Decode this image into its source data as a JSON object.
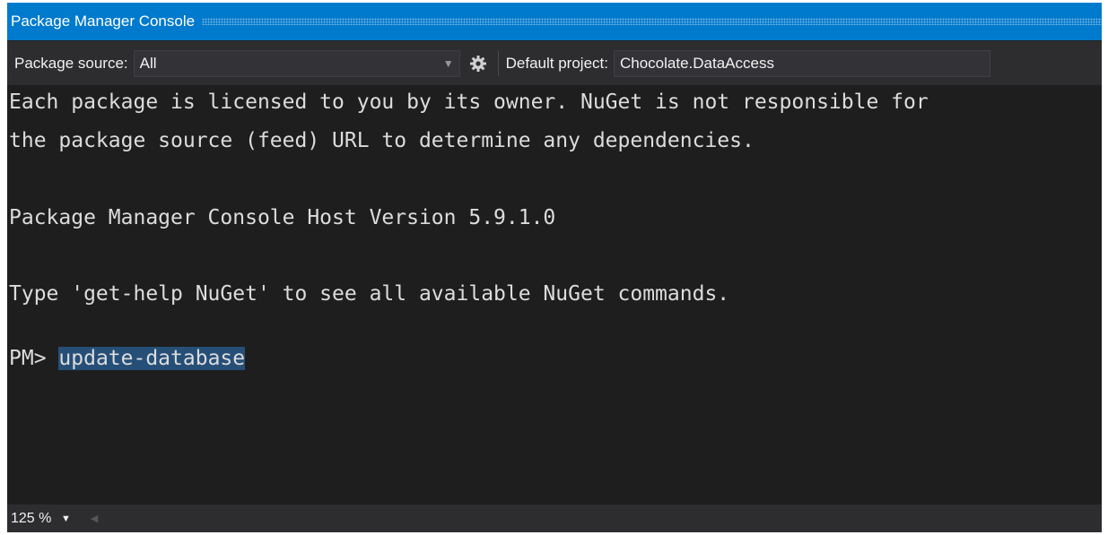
{
  "window": {
    "title": "Package Manager Console"
  },
  "toolbar": {
    "package_source_label": "Package source:",
    "package_source_value": "All",
    "default_project_label": "Default project:",
    "default_project_value": "Chocolate.DataAccess",
    "settings_icon": "gear-icon"
  },
  "console": {
    "lines": [
      "Each package is licensed to you by its owner. NuGet is not responsible for",
      "the package source (feed) URL to determine any dependencies.",
      "",
      "Package Manager Console Host Version 5.9.1.0",
      "",
      "Type 'get-help NuGet' to see all available NuGet commands.",
      ""
    ],
    "prompt": "PM>",
    "command": "update-database"
  },
  "status": {
    "zoom": "125 %"
  },
  "colors": {
    "accent": "#007acc",
    "background": "#1e1e1e",
    "selection": "#264f78"
  }
}
